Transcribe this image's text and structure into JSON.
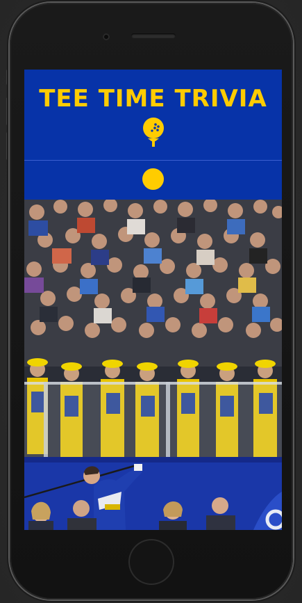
{
  "app": {
    "title": "TEE TIME TRIVIA"
  },
  "colors": {
    "brand_blue": "#0733a8",
    "accent_yellow": "#ffcc00"
  },
  "icons": {
    "logo": "golf-ball-on-tee-icon",
    "status": "yellow-dot-indicator"
  }
}
